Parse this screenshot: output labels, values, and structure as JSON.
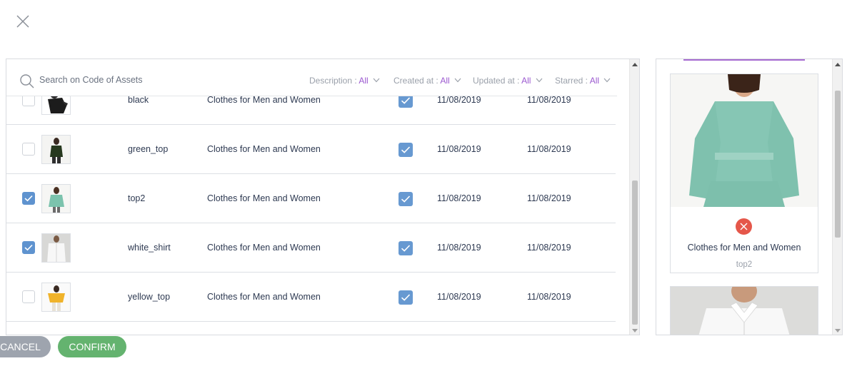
{
  "header": {
    "close_icon": "close-icon"
  },
  "search": {
    "placeholder": "Search on Code of Assets",
    "icon": "search-icon"
  },
  "filters": [
    {
      "label": "Description :",
      "value": "All"
    },
    {
      "label": "Created at :",
      "value": "All"
    },
    {
      "label": "Updated at :",
      "value": "All"
    },
    {
      "label": "Starred :",
      "value": "All"
    }
  ],
  "rows": [
    {
      "selected": false,
      "code": "black",
      "description": "Clothes for Men and Women",
      "starred": true,
      "created": "11/08/2019",
      "updated": "11/08/2019"
    },
    {
      "selected": false,
      "code": "green_top",
      "description": "Clothes for Men and Women",
      "starred": true,
      "created": "11/08/2019",
      "updated": "11/08/2019"
    },
    {
      "selected": true,
      "code": "top2",
      "description": "Clothes for Men and Women",
      "starred": true,
      "created": "11/08/2019",
      "updated": "11/08/2019"
    },
    {
      "selected": true,
      "code": "white_shirt",
      "description": "Clothes for Men and Women",
      "starred": true,
      "created": "11/08/2019",
      "updated": "11/08/2019"
    },
    {
      "selected": false,
      "code": "yellow_top",
      "description": "Clothes for Men and Women",
      "starred": true,
      "created": "11/08/2019",
      "updated": "11/08/2019"
    }
  ],
  "buttons": {
    "cancel": "CANCEL",
    "confirm": "CONFIRM"
  },
  "selected_cards": [
    {
      "title": "Clothes for Men and Women",
      "code": "top2"
    },
    {
      "title": "",
      "code": ""
    }
  ],
  "colors": {
    "accent_purple": "#9b59d0",
    "checkbox_blue": "#5f93cf",
    "confirm_green": "#64b36f",
    "cancel_gray": "#9ea4ae",
    "remove_red": "#e5574a"
  }
}
